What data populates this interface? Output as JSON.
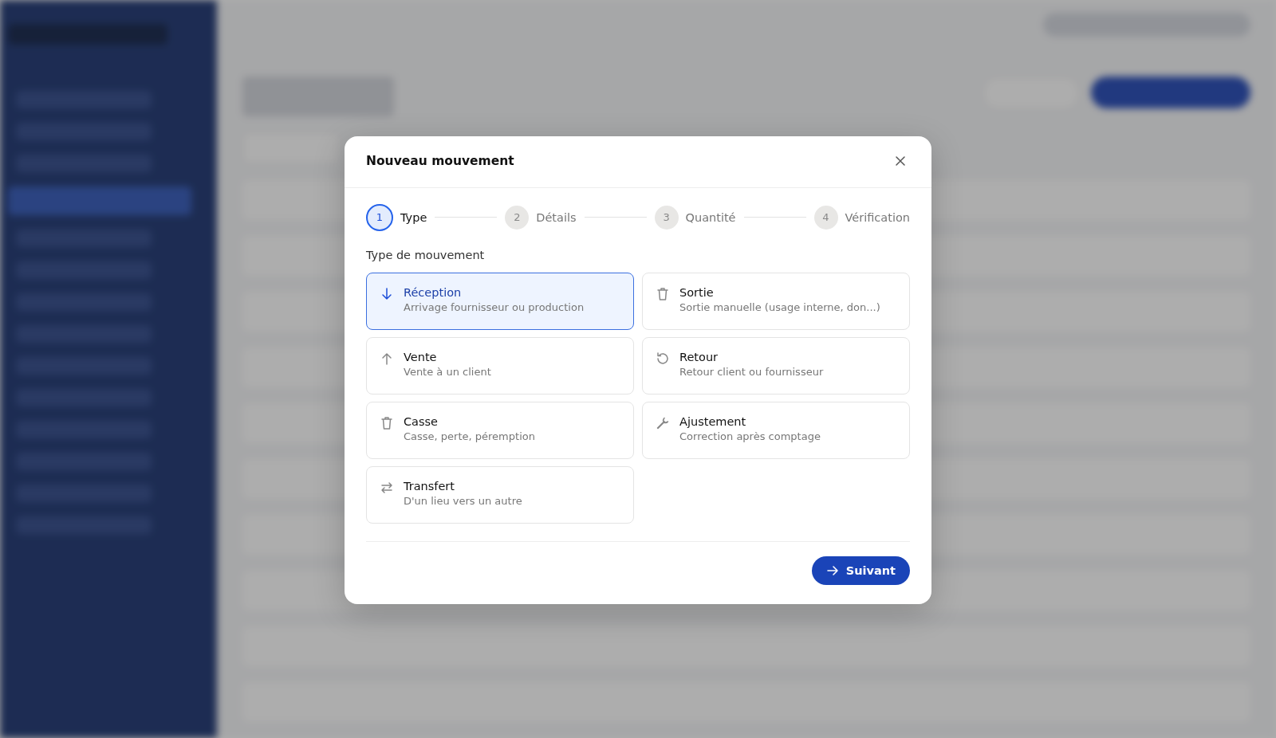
{
  "dialog": {
    "title": "Nouveau mouvement",
    "steps": [
      {
        "number": "1",
        "label": "Type",
        "selected": true
      },
      {
        "number": "2",
        "label": "Détails",
        "selected": false
      },
      {
        "number": "3",
        "label": "Quantité",
        "selected": false
      },
      {
        "number": "4",
        "label": "Vérification",
        "selected": false
      }
    ],
    "section_label": "Type de mouvement",
    "options": [
      {
        "title": "Réception",
        "description": "Arrivage fournisseur ou production",
        "selected": true
      },
      {
        "title": "Sortie",
        "description": "Sortie manuelle (usage interne, don...)",
        "selected": false
      },
      {
        "title": "Vente",
        "description": "Vente à un client",
        "selected": false
      },
      {
        "title": "Retour",
        "description": "Retour client ou fournisseur",
        "selected": false
      },
      {
        "title": "Casse",
        "description": "Casse, perte, péremption",
        "selected": false
      },
      {
        "title": "Ajustement",
        "description": "Correction après comptage",
        "selected": false
      },
      {
        "title": "Transfert",
        "description": "D'un lieu vers un autre",
        "selected": false
      }
    ],
    "next_button": "Suivant"
  }
}
